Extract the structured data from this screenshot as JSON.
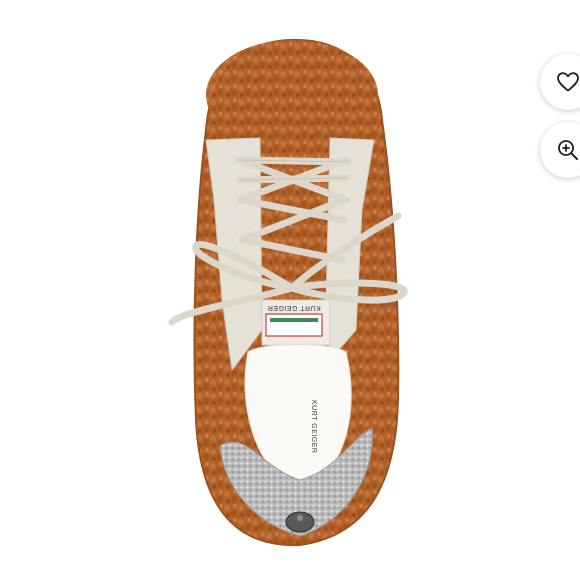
{
  "product": {
    "brand_label": "KURT GEIGER",
    "insole_label": "KURT GEIGER"
  },
  "actions": {
    "favorite_icon": "heart-icon",
    "zoom_icon": "zoom-in-icon"
  },
  "colors": {
    "shearling": "#b5652c",
    "shearling_dark": "#8f4a1c",
    "leather": "#e9e4db",
    "glitter": "#c8c8c8"
  }
}
